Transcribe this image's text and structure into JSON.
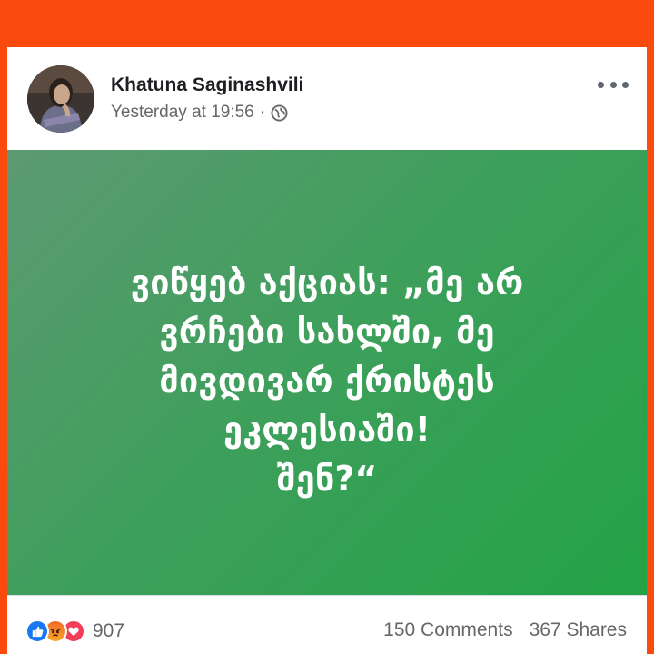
{
  "post": {
    "author": "Khatuna Saginashvili",
    "timestamp": "Yesterday at 19:56",
    "separator": "·",
    "audience_icon": "globe-icon",
    "menu_icon": "more-dots-icon",
    "text": "ვიწყებ აქციას: „მე არ\nვრჩები სახლში, მე\nმივდივარ ქრისტეს\nეკლესიაში!\nშენ?“",
    "background_colors": [
      "#5d9a72",
      "#23a347"
    ],
    "text_color": "#ffffff"
  },
  "footer": {
    "reaction_icons": [
      "like-icon",
      "angry-icon",
      "love-icon"
    ],
    "reaction_count": "907",
    "comments": "150 Comments",
    "shares": "367 Shares"
  },
  "colors": {
    "frame": "#fa4a0e",
    "like": "#1877f2",
    "love": "#f33e58"
  }
}
